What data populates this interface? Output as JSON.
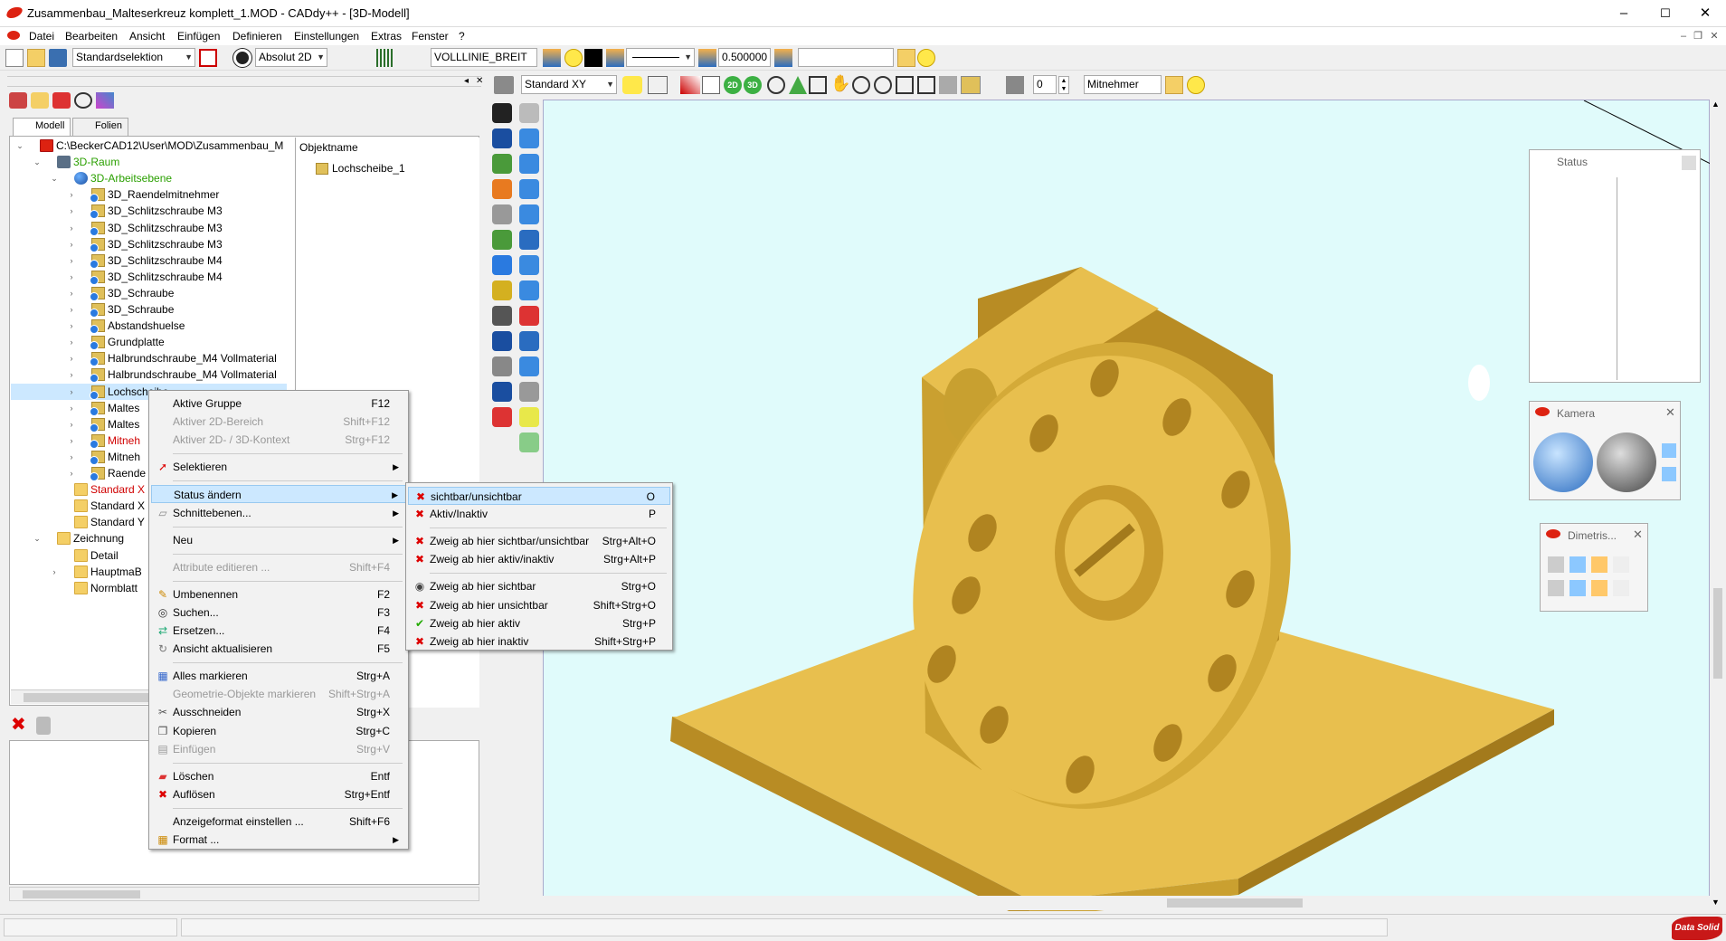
{
  "window": {
    "title": "Zusammenbau_Malteserkreuz komplett_1.MOD  -  CADdy++ - [3D-Modell]",
    "min": "–",
    "max": "☐",
    "close": "✕"
  },
  "menubar": [
    "Datei",
    "Bearbeiten",
    "Ansicht",
    "Einfügen",
    "Definieren",
    "Einstellungen",
    "Extras",
    "Fenster",
    "?"
  ],
  "toolbar1": {
    "selection_mode": "Standardselektion",
    "coord_mode": "Absolut 2D",
    "linetype": "VOLLLINIE_BREIT",
    "linewidth": "0.500000",
    "layer_field": ""
  },
  "toolbar2": {
    "view_combo": "Standard XY",
    "num_field": "0",
    "layer_field": "Mitnehmer",
    "btn_2d": "2D",
    "btn_3d": "3D"
  },
  "tabs": [
    "Modell",
    "Folien"
  ],
  "tree": [
    {
      "label": "C:\\BeckerCAD12\\User\\MOD\\Zusammenbau_M",
      "level": 0,
      "exp": "⌄",
      "icon": "file"
    },
    {
      "label": "3D-Raum",
      "level": 1,
      "exp": "⌄",
      "icon": "cube",
      "color": "green"
    },
    {
      "label": "3D-Arbeitsebene",
      "level": 2,
      "exp": "⌄",
      "icon": "sphere",
      "color": "green"
    },
    {
      "label": "3D_Raendelmitnehmer",
      "level": 3,
      "exp": "›",
      "icon": "part"
    },
    {
      "label": "3D_Schlitzschraube M3",
      "level": 3,
      "exp": "›",
      "icon": "part"
    },
    {
      "label": "3D_Schlitzschraube M3",
      "level": 3,
      "exp": "›",
      "icon": "part"
    },
    {
      "label": "3D_Schlitzschraube M3",
      "level": 3,
      "exp": "›",
      "icon": "part"
    },
    {
      "label": "3D_Schlitzschraube M4",
      "level": 3,
      "exp": "›",
      "icon": "part"
    },
    {
      "label": "3D_Schlitzschraube M4",
      "level": 3,
      "exp": "›",
      "icon": "part"
    },
    {
      "label": "3D_Schraube",
      "level": 3,
      "exp": "›",
      "icon": "part"
    },
    {
      "label": "3D_Schraube",
      "level": 3,
      "exp": "›",
      "icon": "part"
    },
    {
      "label": "Abstandshuelse",
      "level": 3,
      "exp": "›",
      "icon": "part"
    },
    {
      "label": "Grundplatte",
      "level": 3,
      "exp": "›",
      "icon": "part"
    },
    {
      "label": "Halbrundschraube_M4 Vollmaterial",
      "level": 3,
      "exp": "›",
      "icon": "part"
    },
    {
      "label": "Halbrundschraube_M4 Vollmaterial",
      "level": 3,
      "exp": "›",
      "icon": "part"
    },
    {
      "label": "Lochscheibe",
      "level": 3,
      "exp": "›",
      "icon": "part",
      "selected": true
    },
    {
      "label": "Maltes",
      "level": 3,
      "exp": "›",
      "icon": "part"
    },
    {
      "label": "Maltes",
      "level": 3,
      "exp": "›",
      "icon": "part"
    },
    {
      "label": "Mitneh",
      "level": 3,
      "exp": "›",
      "icon": "part",
      "color": "red"
    },
    {
      "label": "Mitneh",
      "level": 3,
      "exp": "›",
      "icon": "part"
    },
    {
      "label": "Raende",
      "level": 3,
      "exp": "›",
      "icon": "part"
    },
    {
      "label": "Standard X",
      "level": 2,
      "exp": "",
      "icon": "folder",
      "color": "red"
    },
    {
      "label": "Standard X",
      "level": 2,
      "exp": "",
      "icon": "folder"
    },
    {
      "label": "Standard Y",
      "level": 2,
      "exp": "",
      "icon": "folder"
    },
    {
      "label": "Zeichnung",
      "level": 1,
      "exp": "⌄",
      "icon": "folder"
    },
    {
      "label": "Detail",
      "level": 2,
      "exp": "",
      "icon": "folder"
    },
    {
      "label": "HauptmaB",
      "level": 2,
      "exp": "›",
      "icon": "folder"
    },
    {
      "label": "Normblatt",
      "level": 2,
      "exp": "",
      "icon": "folder"
    }
  ],
  "objpanel": {
    "header": "Objektname",
    "item": "Lochscheibe_1"
  },
  "context_menu": [
    {
      "label": "Aktive Gruppe",
      "shortcut": "F12"
    },
    {
      "label": "Aktiver 2D-Bereich",
      "shortcut": "Shift+F12",
      "disabled": true
    },
    {
      "label": "Aktiver 2D- / 3D-Kontext",
      "shortcut": "Strg+F12",
      "disabled": true
    },
    {
      "sep": true
    },
    {
      "label": "Selektieren",
      "submenu": true,
      "icon": "pointer-red"
    },
    {
      "sep": true
    },
    {
      "label": "Status ändern",
      "submenu": true,
      "selected": true
    },
    {
      "label": "Schnittebenen...",
      "submenu": true,
      "icon": "plane"
    },
    {
      "sep": true
    },
    {
      "label": "Neu",
      "submenu": true
    },
    {
      "sep": true
    },
    {
      "label": "Attribute editieren ...",
      "shortcut": "Shift+F4",
      "disabled": true
    },
    {
      "sep": true
    },
    {
      "label": "Umbenennen",
      "shortcut": "F2",
      "icon": "pencil"
    },
    {
      "label": "Suchen...",
      "shortcut": "F3",
      "icon": "binoculars"
    },
    {
      "label": "Ersetzen...",
      "shortcut": "F4",
      "icon": "replace"
    },
    {
      "label": "Ansicht aktualisieren",
      "shortcut": "F5",
      "icon": "refresh"
    },
    {
      "sep": true
    },
    {
      "label": "Alles markieren",
      "shortcut": "Strg+A",
      "icon": "select-all"
    },
    {
      "label": "Geometrie-Objekte markieren",
      "shortcut": "Shift+Strg+A",
      "disabled": true
    },
    {
      "label": "Ausschneiden",
      "shortcut": "Strg+X",
      "icon": "scissors"
    },
    {
      "label": "Kopieren",
      "shortcut": "Strg+C",
      "icon": "copy"
    },
    {
      "label": "Einfügen",
      "shortcut": "Strg+V",
      "disabled": true,
      "icon": "paste"
    },
    {
      "sep": true
    },
    {
      "label": "Löschen",
      "shortcut": "Entf",
      "icon": "eraser"
    },
    {
      "label": "Auflösen",
      "shortcut": "Strg+Entf",
      "icon": "x-red"
    },
    {
      "sep": true
    },
    {
      "label": "Anzeigeformat einstellen ...",
      "shortcut": "Shift+F6"
    },
    {
      "label": "Format ...",
      "submenu": true,
      "icon": "table"
    }
  ],
  "submenu": [
    {
      "label": "sichtbar/unsichtbar",
      "shortcut": "O",
      "selected": true,
      "icon": "eye-x"
    },
    {
      "label": "Aktiv/Inaktiv",
      "shortcut": "P",
      "icon": "x-red"
    },
    {
      "sep": true
    },
    {
      "label": "Zweig ab hier sichtbar/unsichtbar",
      "shortcut": "Strg+Alt+O",
      "icon": "eye-x"
    },
    {
      "label": "Zweig ab hier aktiv/inaktiv",
      "shortcut": "Strg+Alt+P",
      "icon": "x-red"
    },
    {
      "sep": true
    },
    {
      "label": "Zweig ab hier sichtbar",
      "shortcut": "Strg+O",
      "icon": "eye"
    },
    {
      "label": "Zweig ab hier unsichtbar",
      "shortcut": "Shift+Strg+O",
      "icon": "eye-x"
    },
    {
      "label": "Zweig ab hier aktiv",
      "shortcut": "Strg+P",
      "icon": "check"
    },
    {
      "label": "Zweig ab hier inaktiv",
      "shortcut": "Shift+Strg+P",
      "icon": "x-red"
    }
  ],
  "panels": {
    "status": {
      "title": "Status"
    },
    "kamera": {
      "title": "Kamera"
    },
    "dimetrisch": {
      "title": "Dimetris..."
    }
  },
  "statusbar": {
    "logo": "Data Solid"
  },
  "colors": {
    "viewport_bg": "#e0fbfb",
    "model": "#e8bf4e",
    "accent_red": "#d21f1f"
  }
}
